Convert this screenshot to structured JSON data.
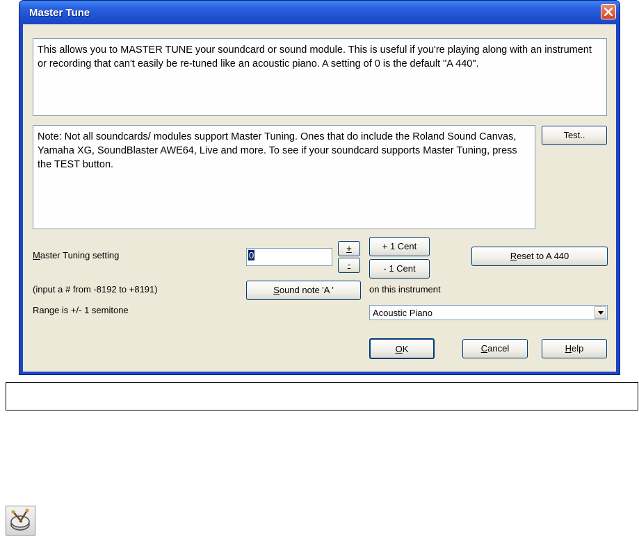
{
  "dialog": {
    "title": "Master Tune",
    "description": "This allows you to MASTER TUNE your soundcard or sound module. This is useful if you're playing along with an instrument or recording that can't easily be re-tuned like an acoustic piano. A setting of 0 is the default \"A  440\".",
    "note": "Note: Not all soundcards/ modules support Master Tuning. Ones that do include the Roland Sound Canvas, Yamaha XG, SoundBlaster AWE64, Live and more. To see if your soundcard supports Master Tuning, press the TEST button.",
    "test_button": "Test..",
    "master_tuning_label": "Master Tuning setting",
    "master_tuning_value": "0",
    "plus_button": "+",
    "minus_button": "-",
    "plus_cent_button": "+ 1 Cent",
    "minus_cent_button": "- 1 Cent",
    "reset_button": "Reset to A 440",
    "input_range_hint": "(input a # from -8192 to +8191)",
    "sound_note_button": "Sound note 'A '",
    "instrument_label": "on this instrument",
    "range_hint": "Range is +/- 1 semitone",
    "instrument_value": "Acoustic Piano",
    "ok_button": "OK",
    "cancel_button": "Cancel",
    "help_button": "Help"
  },
  "caption": "",
  "icons": {
    "close": "close-icon",
    "dropdown": "chevron-down-icon",
    "app": "drum-icon"
  },
  "colors": {
    "titlebar": "#2b62e0",
    "close_button": "#d9431c",
    "dialog_face": "#ece9d8",
    "button_border": "#003c74"
  }
}
